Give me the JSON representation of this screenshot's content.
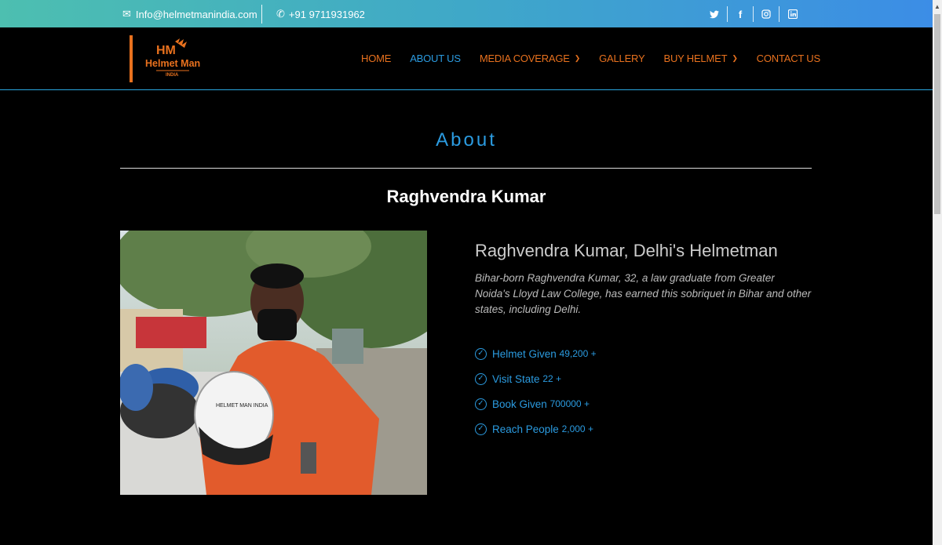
{
  "topbar": {
    "email": "Info@helmetmanindia.com",
    "phone": "+91 9711931962",
    "social": [
      {
        "icon": "twitter-icon",
        "glyph": "🐦"
      },
      {
        "icon": "facebook-icon",
        "glyph": "f"
      },
      {
        "icon": "instagram-icon",
        "glyph": "◎"
      },
      {
        "icon": "linkedin-icon",
        "glyph": "in"
      }
    ]
  },
  "logo": {
    "line1": "Helmet Man",
    "line2": "INDIA",
    "mark": "HM"
  },
  "nav": {
    "home": "HOME",
    "about": "ABOUT US",
    "media": "MEDIA COVERAGE",
    "gallery": "GALLERY",
    "buy": "BUY HELMET",
    "contact": "CONTACT US"
  },
  "page": {
    "about_title": "About",
    "name_heading": "Raghvendra Kumar",
    "subtitle": "Raghvendra Kumar, Delhi's Helmetman",
    "description": "Bihar-born Raghvendra Kumar, 32, a law graduate from Greater Noida's Lloyd Law College, has earned this sobriquet in Bihar and other states, including Delhi."
  },
  "stats": [
    {
      "label": "Helmet Given",
      "value": "49,200 +"
    },
    {
      "label": "Visit State",
      "value": "22 +"
    },
    {
      "label": "Book Given",
      "value": "700000 +"
    },
    {
      "label": "Reach People",
      "value": "2,000 +"
    }
  ],
  "colors": {
    "accent_orange": "#e8711e",
    "accent_blue": "#2b9be0"
  }
}
